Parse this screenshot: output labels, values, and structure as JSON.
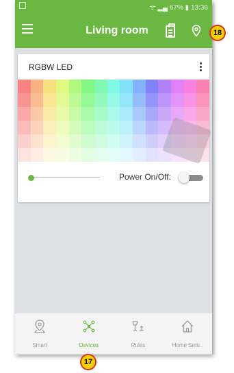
{
  "status_bar": {
    "battery": "67%",
    "time": "13:36"
  },
  "app_bar": {
    "title": "Living room"
  },
  "callouts": {
    "top": "18",
    "bottom": "17"
  },
  "device_card": {
    "title": "RGBW LED",
    "power_label": "Power On/Off:",
    "brightness_level": 0,
    "power_on": false
  },
  "bottom_nav": {
    "items": [
      {
        "label": "Smart",
        "icon": "smart-location-icon",
        "active": false
      },
      {
        "label": "Devices",
        "icon": "devices-network-icon",
        "active": true
      },
      {
        "label": "Rules",
        "icon": "rules-icon",
        "active": false
      },
      {
        "label": "Home Setu..",
        "icon": "home-setup-icon",
        "active": false
      }
    ]
  },
  "colors": {
    "accent": "#6ab842",
    "callout_fill": "#f5d000",
    "callout_border": "#d83020"
  }
}
